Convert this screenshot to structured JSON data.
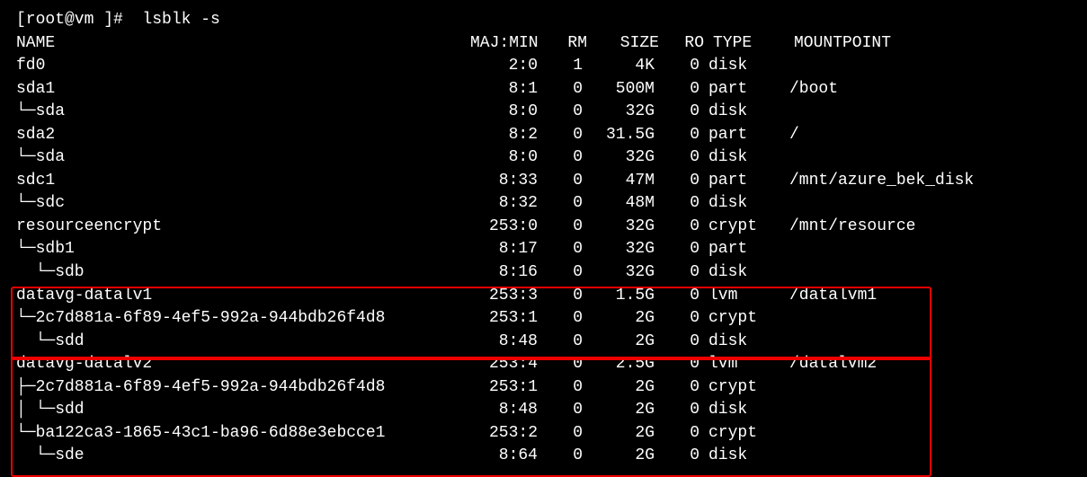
{
  "prompt": "[root@vm ]#  lsblk -s",
  "header": {
    "name": "NAME",
    "majmin": "MAJ:MIN",
    "rm": "RM",
    "size": "SIZE",
    "ro": "RO",
    "type": "TYPE",
    "mount": "MOUNTPOINT"
  },
  "rows": [
    {
      "name": "fd0",
      "majmin": "2:0",
      "rm": "1",
      "size": "4K",
      "ro": "0",
      "type": "disk",
      "mount": ""
    },
    {
      "name": "sda1",
      "majmin": "8:1",
      "rm": "0",
      "size": "500M",
      "ro": "0",
      "type": "part",
      "mount": "/boot"
    },
    {
      "name": "└─sda",
      "majmin": "8:0",
      "rm": "0",
      "size": "32G",
      "ro": "0",
      "type": "disk",
      "mount": ""
    },
    {
      "name": "sda2",
      "majmin": "8:2",
      "rm": "0",
      "size": "31.5G",
      "ro": "0",
      "type": "part",
      "mount": "/"
    },
    {
      "name": "└─sda",
      "majmin": "8:0",
      "rm": "0",
      "size": "32G",
      "ro": "0",
      "type": "disk",
      "mount": ""
    },
    {
      "name": "sdc1",
      "majmin": "8:33",
      "rm": "0",
      "size": "47M",
      "ro": "0",
      "type": "part",
      "mount": "/mnt/azure_bek_disk"
    },
    {
      "name": "└─sdc",
      "majmin": "8:32",
      "rm": "0",
      "size": "48M",
      "ro": "0",
      "type": "disk",
      "mount": ""
    },
    {
      "name": "resourceencrypt",
      "majmin": "253:0",
      "rm": "0",
      "size": "32G",
      "ro": "0",
      "type": "crypt",
      "mount": "/mnt/resource"
    },
    {
      "name": "└─sdb1",
      "majmin": "8:17",
      "rm": "0",
      "size": "32G",
      "ro": "0",
      "type": "part",
      "mount": ""
    },
    {
      "name": "  └─sdb",
      "majmin": "8:16",
      "rm": "0",
      "size": "32G",
      "ro": "0",
      "type": "disk",
      "mount": ""
    },
    {
      "name": "datavg-datalv1",
      "majmin": "253:3",
      "rm": "0",
      "size": "1.5G",
      "ro": "0",
      "type": "lvm",
      "mount": "/datalvm1"
    },
    {
      "name": "└─2c7d881a-6f89-4ef5-992a-944bdb26f4d8",
      "majmin": "253:1",
      "rm": "0",
      "size": "2G",
      "ro": "0",
      "type": "crypt",
      "mount": ""
    },
    {
      "name": "  └─sdd",
      "majmin": "8:48",
      "rm": "0",
      "size": "2G",
      "ro": "0",
      "type": "disk",
      "mount": ""
    },
    {
      "name": "datavg-datalv2",
      "majmin": "253:4",
      "rm": "0",
      "size": "2.5G",
      "ro": "0",
      "type": "lvm",
      "mount": "/datalvm2"
    },
    {
      "name": "├─2c7d881a-6f89-4ef5-992a-944bdb26f4d8",
      "majmin": "253:1",
      "rm": "0",
      "size": "2G",
      "ro": "0",
      "type": "crypt",
      "mount": ""
    },
    {
      "name": "│ └─sdd",
      "majmin": "8:48",
      "rm": "0",
      "size": "2G",
      "ro": "0",
      "type": "disk",
      "mount": ""
    },
    {
      "name": "└─ba122ca3-1865-43c1-ba96-6d88e3ebcce1",
      "majmin": "253:2",
      "rm": "0",
      "size": "2G",
      "ro": "0",
      "type": "crypt",
      "mount": ""
    },
    {
      "name": "  └─sde",
      "majmin": "8:64",
      "rm": "0",
      "size": "2G",
      "ro": "0",
      "type": "disk",
      "mount": ""
    }
  ]
}
